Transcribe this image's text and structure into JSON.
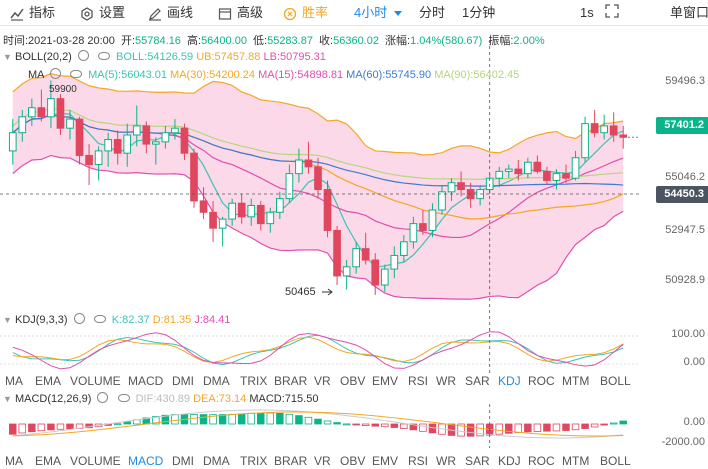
{
  "toolbar": {
    "indicators": "指标",
    "settings": "设置",
    "draw": "画线",
    "advanced": "高级",
    "winrate": "胜率",
    "interval": "4小时",
    "minute": "分时",
    "one_min": "1分钟",
    "one_sec": "1s",
    "single_window": "单窗口"
  },
  "info": {
    "time": "时间:2021-03-28 20:00",
    "open_label": "开:",
    "open": "55784.16",
    "high_label": "高:",
    "high": "56400.00",
    "low_label": "低:",
    "low": "55283.87",
    "close_label": "收:",
    "close": "56360.02",
    "change_label": "涨幅:",
    "change": "1.04%(580.67)",
    "amp_label": "振幅:",
    "amp": "2.00%"
  },
  "boll": {
    "name": "BOLL(20,2)",
    "boll": "BOLL:54126.59",
    "ub": "UB:57457.88",
    "lb": "LB:50795.31"
  },
  "ma": {
    "name": "MA",
    "ma5": "MA(5):56043.01",
    "ma30": "MA(30):54200.24",
    "ma15": "MA(15):54898.81",
    "ma60": "MA(60):55745.90",
    "ma90": "MA(90):56402.45"
  },
  "price_axis": [
    "59496.3",
    "55046.2",
    "52947.5",
    "50928.9"
  ],
  "current_price": "57401.2",
  "crosshair_price": "54450.3",
  "annotations": {
    "high": "59900",
    "low": "50465"
  },
  "kdj": {
    "name": "KDJ(9,3,3)",
    "k": "K:82.37",
    "d": "D:81.35",
    "j": "J:84.41",
    "axis": [
      "100.00",
      "0.00"
    ]
  },
  "indicator_tabs": [
    "MA",
    "EMA",
    "VOLUME",
    "MACD",
    "DMI",
    "DMA",
    "TRIX",
    "BRAR",
    "VR",
    "OBV",
    "EMV",
    "RSI",
    "WR",
    "SAR",
    "KDJ",
    "ROC",
    "MTM",
    "BOLL"
  ],
  "macd": {
    "name": "MACD(12,26,9)",
    "dif": "DIF:430.89",
    "dea": "DEA:73.14",
    "macd": "MACD:715.50",
    "axis": [
      "0.00",
      "-2000.00"
    ]
  },
  "indicator_tabs2": [
    "MA",
    "EMA",
    "VOLUME",
    "MACD",
    "DMI",
    "DMA",
    "TRIX",
    "BRAR",
    "VR",
    "OBV",
    "EMV",
    "RSI",
    "WR",
    "SAR",
    "KDJ",
    "ROC",
    "MTM",
    "BOLL"
  ],
  "colors": {
    "up": "#0bb389",
    "down": "#e0475f",
    "accent": "#1e8ae6",
    "winrate": "#f5a623",
    "boll_fill": "#fbd5e5",
    "ub": "#f5a623",
    "lb": "#e04fb0",
    "ma5": "#3ec3b0",
    "ma30": "#f5a623",
    "ma15": "#e04fb0",
    "ma60": "#3a7bd5",
    "ma90": "#b5d67a"
  },
  "candles": [
    [
      56800,
      58200,
      56200,
      57600
    ],
    [
      57600,
      58600,
      57200,
      58300
    ],
    [
      58300,
      59100,
      57900,
      58700
    ],
    [
      58700,
      59500,
      58100,
      58300
    ],
    [
      58300,
      59900,
      57800,
      59100
    ],
    [
      59100,
      59300,
      57500,
      57800
    ],
    [
      57800,
      58600,
      57300,
      58200
    ],
    [
      58200,
      58300,
      56200,
      56600
    ],
    [
      56600,
      57100,
      55300,
      56200
    ],
    [
      56200,
      57000,
      55500,
      56800
    ],
    [
      56800,
      57600,
      56100,
      57300
    ],
    [
      57300,
      57700,
      56200,
      56700
    ],
    [
      56700,
      58000,
      56100,
      57500
    ],
    [
      57500,
      58800,
      57000,
      57900
    ],
    [
      57900,
      58100,
      56700,
      57100
    ],
    [
      57100,
      57400,
      56200,
      57200
    ],
    [
      57200,
      57900,
      56900,
      57600
    ],
    [
      57600,
      58200,
      57300,
      57800
    ],
    [
      57800,
      58000,
      56400,
      56700
    ],
    [
      56700,
      56900,
      54300,
      54600
    ],
    [
      54600,
      55200,
      53800,
      54100
    ],
    [
      54100,
      54600,
      52800,
      53400
    ],
    [
      53400,
      53900,
      52600,
      53800
    ],
    [
      53800,
      54700,
      53500,
      54500
    ],
    [
      54500,
      54900,
      53600,
      53900
    ],
    [
      53900,
      54700,
      53500,
      54400
    ],
    [
      54400,
      54600,
      53300,
      53600
    ],
    [
      53600,
      54300,
      53200,
      54100
    ],
    [
      54100,
      55000,
      53800,
      54700
    ],
    [
      54700,
      56200,
      54500,
      55800
    ],
    [
      55800,
      56900,
      55400,
      56400
    ],
    [
      56400,
      57200,
      55800,
      56100
    ],
    [
      56100,
      56500,
      54700,
      55100
    ],
    [
      55100,
      55500,
      53000,
      53300
    ],
    [
      53300,
      53500,
      50900,
      51300
    ],
    [
      51300,
      52000,
      50700,
      51700
    ],
    [
      51700,
      52800,
      51400,
      52500
    ],
    [
      52500,
      53200,
      51800,
      52000
    ],
    [
      52000,
      52300,
      50465,
      50900
    ],
    [
      50900,
      51800,
      50600,
      51600
    ],
    [
      51600,
      52600,
      51200,
      52200
    ],
    [
      52200,
      53100,
      51900,
      52800
    ],
    [
      52800,
      53900,
      52500,
      53600
    ],
    [
      53600,
      54200,
      53100,
      53300
    ],
    [
      53300,
      54500,
      53000,
      54200
    ],
    [
      54200,
      55300,
      54000,
      55000
    ],
    [
      55000,
      55600,
      54600,
      55400
    ],
    [
      55400,
      55900,
      54800,
      55100
    ],
    [
      55100,
      55400,
      54300,
      54700
    ],
    [
      54700,
      55300,
      54400,
      55100
    ],
    [
      55100,
      55800,
      54900,
      55600
    ],
    [
      55600,
      56100,
      55200,
      55900
    ],
    [
      55900,
      56200,
      55600,
      56000
    ],
    [
      56000,
      56400,
      55500,
      55800
    ],
    [
      55800,
      56500,
      55600,
      56300
    ],
    [
      56300,
      56600,
      55800,
      55900
    ],
    [
      55900,
      56100,
      55300,
      55500
    ],
    [
      55500,
      56000,
      55100,
      55800
    ],
    [
      55800,
      56200,
      55400,
      55600
    ],
    [
      55600,
      56800,
      55500,
      56500
    ],
    [
      56500,
      58300,
      56300,
      58000
    ],
    [
      58000,
      58600,
      57400,
      57600
    ],
    [
      57600,
      58400,
      57300,
      57900
    ],
    [
      57900,
      58500,
      57200,
      57500
    ],
    [
      57500,
      57900,
      56900,
      57400
    ]
  ]
}
